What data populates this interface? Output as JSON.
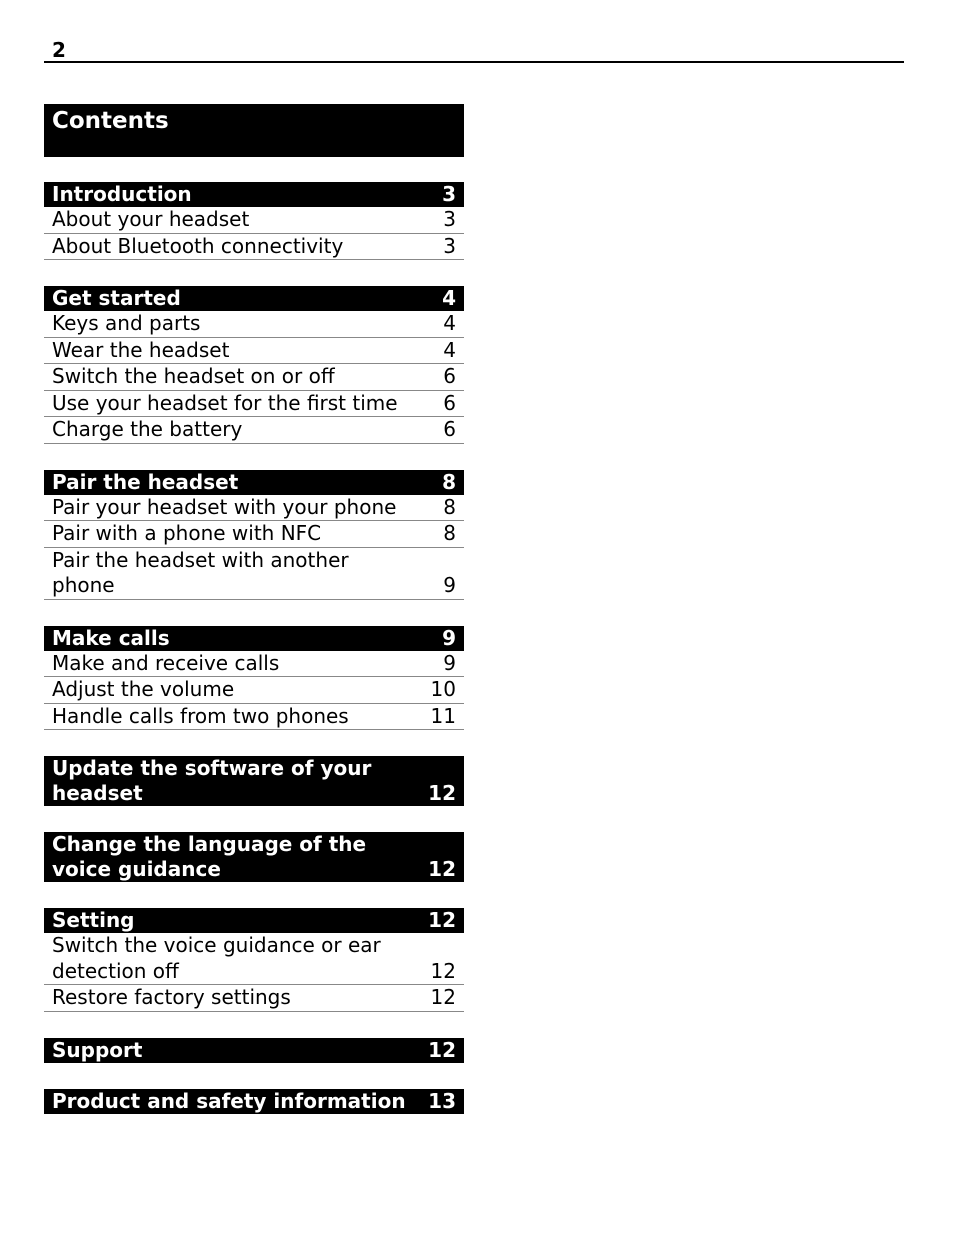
{
  "page_number": "2",
  "title": "Contents",
  "sections": [
    {
      "title": "Introduction",
      "page": "3",
      "items": [
        {
          "title": "About your headset",
          "page": "3"
        },
        {
          "title": "About Bluetooth connectivity",
          "page": "3"
        }
      ]
    },
    {
      "title": "Get started",
      "page": "4",
      "items": [
        {
          "title": "Keys and parts",
          "page": "4"
        },
        {
          "title": "Wear the headset",
          "page": "4"
        },
        {
          "title": "Switch the headset on or off",
          "page": "6"
        },
        {
          "title": "Use your headset for the first time",
          "page": "6"
        },
        {
          "title": "Charge the battery",
          "page": "6"
        }
      ]
    },
    {
      "title": "Pair the headset",
      "page": "8",
      "items": [
        {
          "title": "Pair your headset with your phone",
          "page": "8"
        },
        {
          "title": "Pair with a phone with NFC",
          "page": "8"
        },
        {
          "title": "Pair the headset with another phone",
          "page": "9"
        }
      ]
    },
    {
      "title": "Make calls",
      "page": "9",
      "items": [
        {
          "title": "Make and receive calls",
          "page": "9"
        },
        {
          "title": "Adjust the volume",
          "page": "10"
        },
        {
          "title": "Handle calls from two phones",
          "page": "11"
        }
      ]
    },
    {
      "title": "Update the software of your headset",
      "page": "12",
      "items": []
    },
    {
      "title": "Change the language of the voice guidance",
      "page": "12",
      "items": []
    },
    {
      "title": "Setting",
      "page": "12",
      "items": [
        {
          "title": "Switch the voice guidance or ear detection off",
          "page": "12"
        },
        {
          "title": "Restore factory settings",
          "page": "12"
        }
      ]
    },
    {
      "title": "Support",
      "page": "12",
      "items": []
    },
    {
      "title": "Product and safety information",
      "page": "13",
      "items": []
    }
  ]
}
